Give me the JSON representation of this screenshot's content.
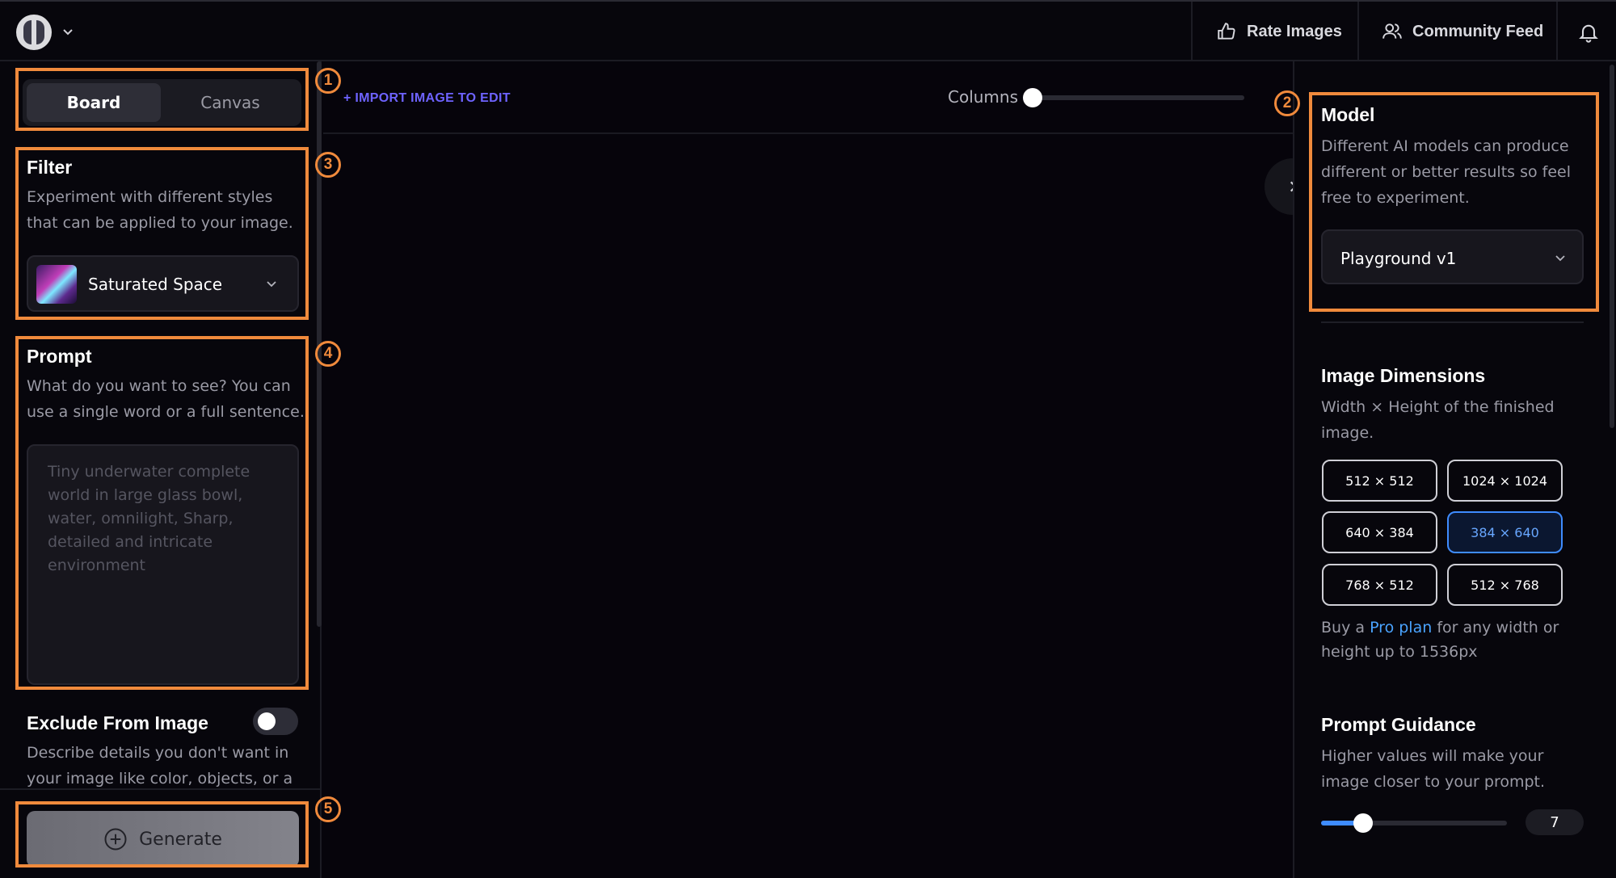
{
  "topbar": {
    "rate_images": "Rate Images",
    "community_feed": "Community Feed"
  },
  "left": {
    "tabs": [
      "Board",
      "Canvas"
    ],
    "filter": {
      "title": "Filter",
      "description": "Experiment with different styles that can be applied to your image.",
      "selected": "Saturated Space"
    },
    "prompt": {
      "title": "Prompt",
      "description": "What do you want to see? You can use a single word or a full sentence.",
      "placeholder": "Tiny underwater complete world in large glass bowl, water, omnilight, Sharp, detailed and intricate environment"
    },
    "exclude": {
      "title": "Exclude From Image",
      "description": "Describe details you don't want in your image like color, objects, or a",
      "enabled": false
    },
    "generate_label": "Generate"
  },
  "center": {
    "import_label": "+ IMPORT IMAGE TO EDIT",
    "columns_label": "Columns",
    "columns_value": 0
  },
  "right": {
    "model": {
      "title": "Model",
      "description": "Different AI models can produce different or better results so feel free to experiment.",
      "selected": "Playground v1"
    },
    "dimensions": {
      "title": "Image Dimensions",
      "description": "Width × Height of the finished image.",
      "options": [
        "512 × 512",
        "1024 × 1024",
        "640 × 384",
        "384 × 640",
        "768 × 512",
        "512 × 768"
      ],
      "selected": "384 × 640",
      "note_prefix": "Buy a",
      "note_link": "Pro plan",
      "note_suffix": "for any width or height up to 1536px"
    },
    "guidance": {
      "title": "Prompt Guidance",
      "description": "Higher values will make your image closer to your prompt.",
      "value": "7"
    }
  },
  "annotations": [
    "1",
    "2",
    "3",
    "4",
    "5"
  ],
  "colors": {
    "accent_highlight": "#f08a3c",
    "selected_blue": "#3f8cff",
    "import_purple": "#6e63ff",
    "link_blue": "#4aa3ff"
  }
}
